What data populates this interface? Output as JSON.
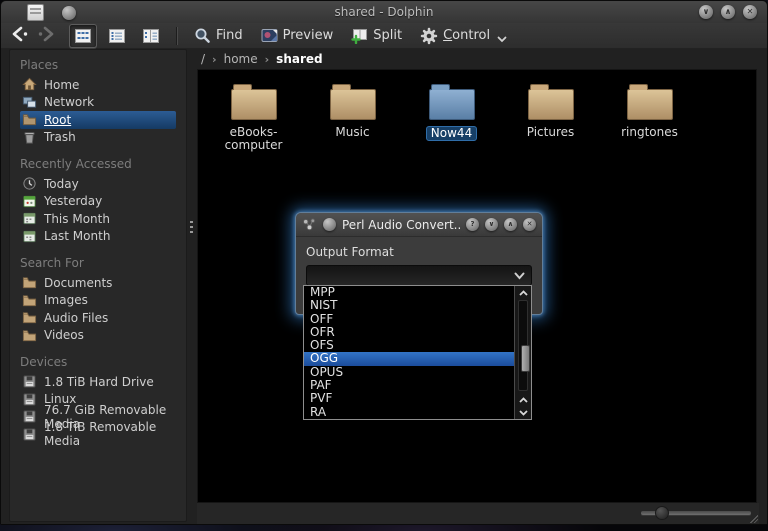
{
  "window": {
    "title": "shared - Dolphin"
  },
  "toolbar": {
    "find_label": "Find",
    "preview_label": "Preview",
    "split_label": "Split",
    "control_mnemonic": "C",
    "control_rest": "ontrol"
  },
  "breadcrumb": {
    "root": "/",
    "home": "home",
    "current": "shared"
  },
  "sidebar": {
    "sections": [
      {
        "title": "Places",
        "items": [
          {
            "label": "Home"
          },
          {
            "label": "Network"
          },
          {
            "label": "Root"
          },
          {
            "label": "Trash"
          }
        ]
      },
      {
        "title": "Recently Accessed",
        "items": [
          {
            "label": "Today"
          },
          {
            "label": "Yesterday"
          },
          {
            "label": "This Month"
          },
          {
            "label": "Last Month"
          }
        ]
      },
      {
        "title": "Search For",
        "items": [
          {
            "label": "Documents"
          },
          {
            "label": "Images"
          },
          {
            "label": "Audio Files"
          },
          {
            "label": "Videos"
          }
        ]
      },
      {
        "title": "Devices",
        "items": [
          {
            "label": "1.8 TiB Hard Drive"
          },
          {
            "label": "Linux"
          },
          {
            "label": "76.7 GiB Removable Media"
          },
          {
            "label": "1.8 TiB Removable Media"
          }
        ]
      }
    ],
    "selected_item": "Root"
  },
  "folders": [
    {
      "name": "eBooks-computer"
    },
    {
      "name": "Music"
    },
    {
      "name": "Now44"
    },
    {
      "name": "Pictures"
    },
    {
      "name": "ringtones"
    }
  ],
  "selected_folder": "Now44",
  "dialog": {
    "title": "Perl Audio Convert...",
    "output_format_label": "Output Format",
    "combobox_value": "",
    "format_list": [
      "MPP",
      "NIST",
      "OFF",
      "OFR",
      "OFS",
      "OGG",
      "OPUS",
      "PAF",
      "PVF",
      "RA"
    ],
    "selected_format": "OGG"
  },
  "colors": {
    "selection_blue": "#2a66b4",
    "folder_tan": "#c7a97c",
    "folder_blue": "#7397bd",
    "dialog_glow": "#3f8fdc",
    "window_bg": "#2d2d2d",
    "view_bg": "#000000"
  }
}
